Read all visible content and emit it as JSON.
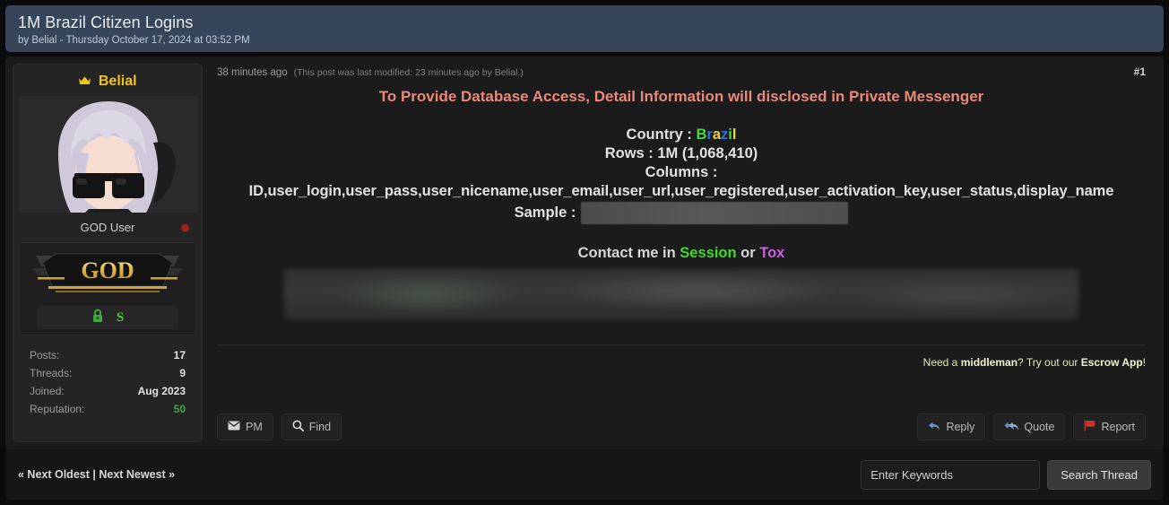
{
  "thread": {
    "title": "1M Brazil Citizen Logins",
    "byline": "by Belial - Thursday October 17, 2024 at 03:52 PM"
  },
  "post": {
    "date": "38 minutes ago",
    "edited": "(This post was last modified: 23 minutes ago by Belial.)",
    "number": "#1",
    "headline": "To Provide Database Access, Detail Information will disclosed in Private Messenger",
    "country_label": "Country : ",
    "country_letters": [
      {
        "ch": "B",
        "color": "#3ddc3d"
      },
      {
        "ch": "r",
        "color": "#2f6fe0"
      },
      {
        "ch": "a",
        "color": "#e8d44d"
      },
      {
        "ch": "z",
        "color": "#2f6fe0"
      },
      {
        "ch": "i",
        "color": "#3ddc3d"
      },
      {
        "ch": "l",
        "color": "#e8d44d"
      }
    ],
    "rows_line": "Rows : 1M (1,068,410)",
    "columns_label": "Columns :",
    "columns_list": "ID,user_login,user_pass,user_nicename,user_email,user_url,user_registered,user_activation_key,user_status,display_name",
    "sample_label": "Sample :",
    "contact_prefix": "Contact me in ",
    "contact_session": "Session",
    "contact_joiner": " or ",
    "contact_tox": "Tox"
  },
  "author": {
    "name": "Belial",
    "usertitle": "GOD User",
    "rank_badge": "GOD",
    "stats": [
      {
        "label": "Posts:",
        "value": "17",
        "accent": false
      },
      {
        "label": "Threads:",
        "value": "9",
        "accent": false
      },
      {
        "label": "Joined:",
        "value": "Aug 2023",
        "accent": false
      },
      {
        "label": "Reputation:",
        "value": "50",
        "accent": true
      }
    ]
  },
  "escrow": {
    "pre": "Need a ",
    "bold1": "middleman",
    "mid": "? Try out our ",
    "bold2": "Escrow App",
    "post": "!"
  },
  "actions": {
    "pm": "PM",
    "find": "Find",
    "reply": "Reply",
    "quote": "Quote",
    "report": "Report"
  },
  "bottom": {
    "next_oldest": "« Next Oldest",
    "divider": " | ",
    "next_newest": "Next Newest »",
    "search_placeholder": "Enter Keywords",
    "search_button": "Search Thread"
  },
  "colors": {
    "header_bg": "#364559",
    "headline": "#e8897d",
    "session_green": "#44d62c",
    "tox_purple": "#cb5ee8",
    "rep_green": "#3ea93e",
    "crown_gold": "#f0c419",
    "status_offline": "#9b2222"
  }
}
